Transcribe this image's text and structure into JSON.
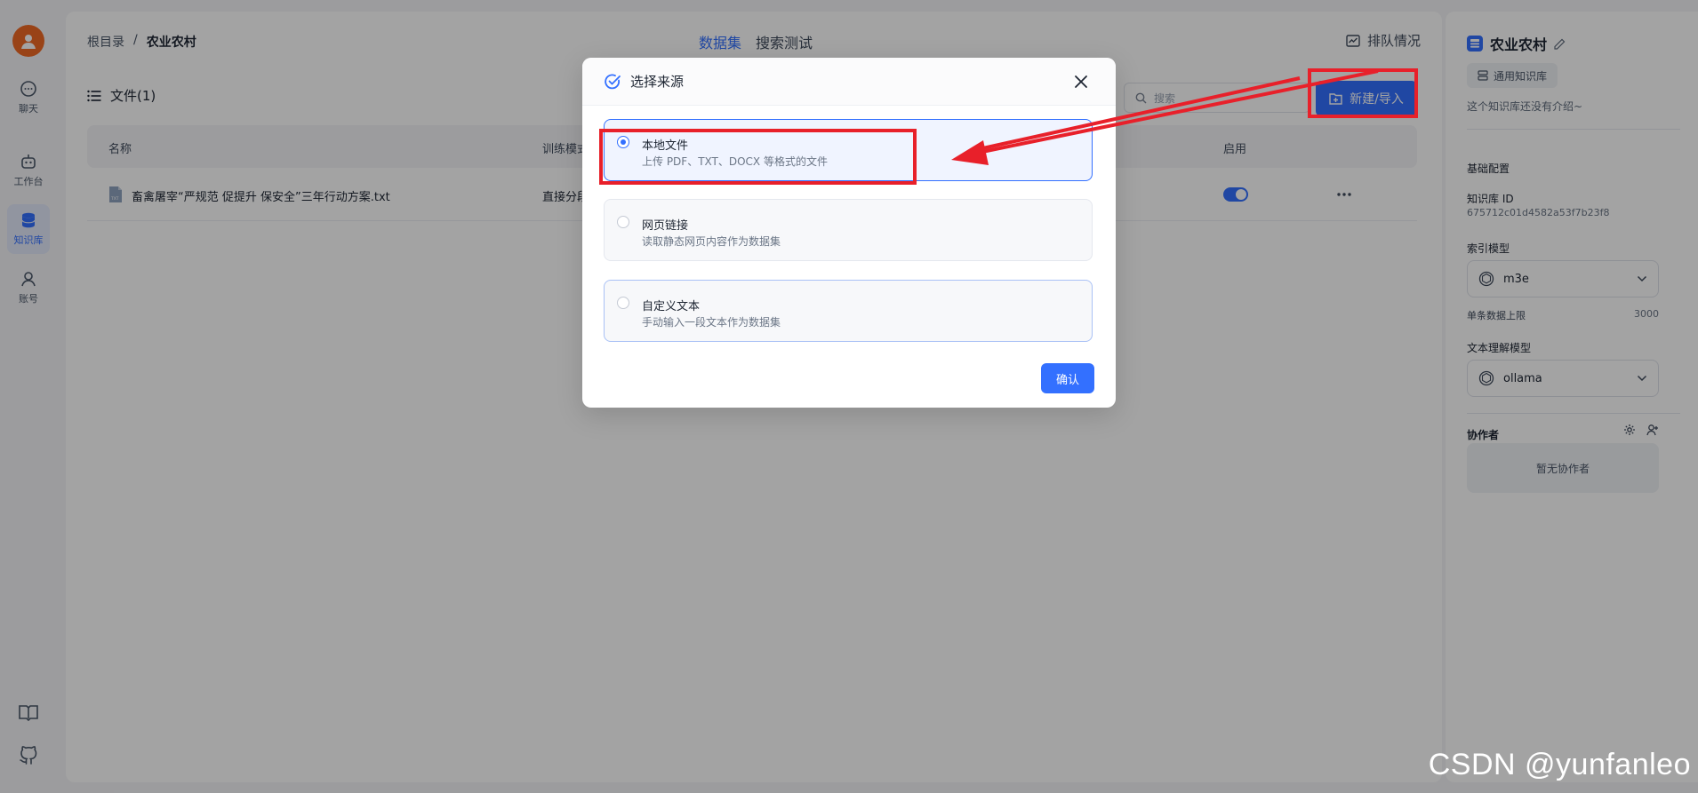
{
  "nav": {
    "items": [
      {
        "label": "聊天",
        "icon": "chat-icon"
      },
      {
        "label": "工作台",
        "icon": "robot-icon"
      },
      {
        "label": "知识库",
        "icon": "database-icon"
      },
      {
        "label": "账号",
        "icon": "user-icon"
      }
    ]
  },
  "header": {
    "breadcrumb_root": "根目录",
    "breadcrumb_sep": "/",
    "breadcrumb_current": "农业农村",
    "tab_dataset": "数据集",
    "tab_search": "搜索测试",
    "queue_label": "排队情况"
  },
  "toolbar": {
    "files_label": "文件(1)",
    "search_placeholder": "搜索",
    "new_import_label": "新建/导入"
  },
  "table": {
    "headers": {
      "name": "名称",
      "mode": "训练模式",
      "enabled": "启用"
    },
    "rows": [
      {
        "name": "畜禽屠宰“严规范 促提升 保安全”三年行动方案.txt",
        "mode": "直接分段",
        "enabled": true
      }
    ]
  },
  "side": {
    "title": "农业农村",
    "tag": "通用知识库",
    "intro": "这个知识库还没有介绍~",
    "basic_config": "基础配置",
    "kb_id_label": "知识库 ID",
    "kb_id": "675712c01d4582a53f7b23f8",
    "index_model_label": "索引模型",
    "index_model": "m3e",
    "max_chunk_label": "单条数据上限",
    "max_chunk": "3000",
    "text_model_label": "文本理解模型",
    "text_model": "ollama",
    "collab_label": "协作者",
    "collab_empty": "暂无协作者"
  },
  "modal": {
    "title": "选择来源",
    "options": [
      {
        "title": "本地文件",
        "desc": "上传 PDF、TXT、DOCX 等格式的文件",
        "selected": true
      },
      {
        "title": "网页链接",
        "desc": "读取静态网页内容作为数据集",
        "selected": false
      },
      {
        "title": "自定义文本",
        "desc": "手动输入一段文本作为数据集",
        "selected": false
      }
    ],
    "confirm_label": "确认"
  },
  "watermark": "CSDN @yunfanleo",
  "colors": {
    "accent": "#3370ff",
    "avatar": "#f06a25",
    "annotation": "#e8202a"
  }
}
